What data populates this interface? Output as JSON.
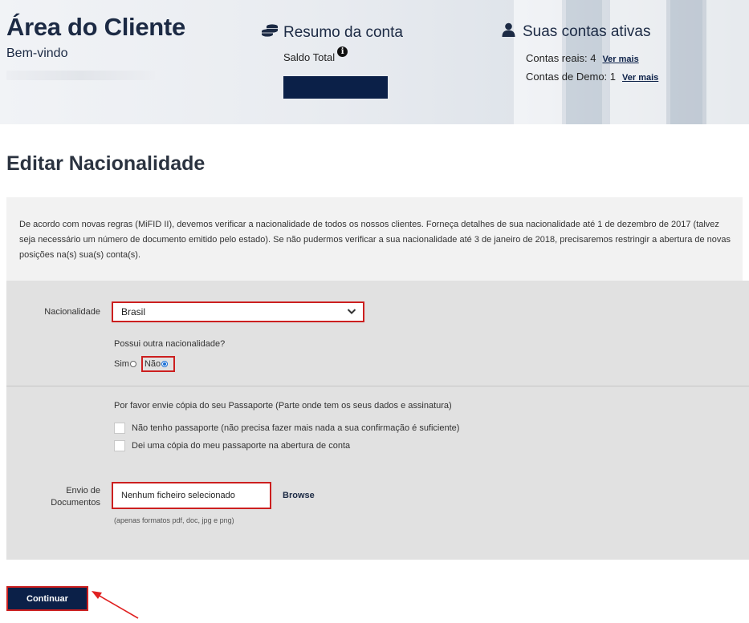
{
  "header": {
    "title": "Área do Cliente",
    "welcome": "Bem-vindo",
    "summary": {
      "icon": "coins-icon",
      "title": "Resumo da conta",
      "balance_label": "Saldo Total",
      "info_icon": "info-icon",
      "info_glyph": "i"
    },
    "accounts": {
      "icon": "user-icon",
      "title": "Suas contas ativas",
      "real_label": "Contas reais: 4",
      "demo_label": "Contas de Demo: 1",
      "more_link": "Ver mais"
    }
  },
  "page": {
    "title": "Editar Nacionalidade",
    "notice": "De acordo com novas regras (MiFID II), devemos verificar a nacionalidade de todos os nossos clientes. Forneça detalhes de sua nacionalidade até 1 de dezembro de 2017 (talvez seja necessário um número de documento emitido pelo estado). Se não pudermos verificar a sua nacionalidade até 3 de janeiro de 2018, precisaremos restringir a abertura de novas posições na(s) sua(s) conta(s)."
  },
  "form": {
    "nationality_label": "Nacionalidade",
    "nationality_value": "Brasil",
    "other_question": "Possui outra nacionalidade?",
    "option_yes": "Sim",
    "option_no": "Não",
    "selected_option": "Não",
    "passport_text": "Por favor envie cópia do seu Passaporte (Parte onde tem os seus dados e assinatura)",
    "checkbox_1": "Não tenho passaporte (não precisa fazer mais nada a sua confirmação é suficiente)",
    "checkbox_2": "Dei uma cópia do meu passaporte na abertura de conta",
    "documents_label_1": "Envio de",
    "documents_label_2": "Documentos",
    "file_placeholder": "Nenhum ficheiro selecionado",
    "browse_label": "Browse",
    "formats_hint": "(apenas formatos pdf, doc, jpg e png)"
  },
  "actions": {
    "continue_label": "Continuar"
  },
  "colors": {
    "navy": "#0b2048",
    "highlight_red": "#cc1f1f",
    "panel_gray": "#e1e1e1",
    "notice_gray": "#f2f2f2"
  }
}
